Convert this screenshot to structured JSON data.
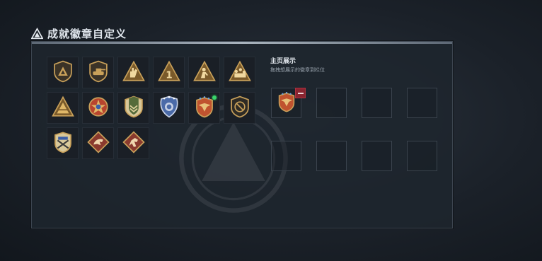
{
  "header": {
    "title": "成就徽章自定义",
    "icon": "triangle-logo-icon"
  },
  "badges": [
    {
      "icon": "shield-triangle-badge-icon",
      "row": 1
    },
    {
      "icon": "tank-badge-icon",
      "row": 1
    },
    {
      "icon": "hand-triangle-badge-icon",
      "row": 1
    },
    {
      "icon": "number-one-triangle-badge-icon",
      "row": 1
    },
    {
      "icon": "soldier-triangle-badge-icon",
      "row": 1
    },
    {
      "icon": "squad-triangle-badge-icon",
      "row": 1
    },
    {
      "icon": "gold-triangle-badge-icon",
      "row": 2
    },
    {
      "icon": "star-medal-badge-icon",
      "row": 2
    },
    {
      "icon": "chevron-shield-badge-icon",
      "row": 2
    },
    {
      "icon": "police-badge-icon",
      "row": 2
    },
    {
      "icon": "eagle-crest-badge-icon",
      "row": 2,
      "is_new": true
    },
    {
      "icon": "no-sign-shield-badge-icon",
      "row": 2
    },
    {
      "icon": "crossed-rifles-crest-badge-icon",
      "row": 3
    },
    {
      "icon": "beast-diamond-badge-icon",
      "row": 3
    },
    {
      "icon": "horse-diamond-badge-icon",
      "row": 3
    }
  ],
  "showcase": {
    "title": "主页展示",
    "subtitle": "拖拽想展示的徽章到栏位",
    "slots": [
      {
        "filled": true,
        "icon": "eagle-crest-badge-icon"
      },
      {
        "filled": false
      },
      {
        "filled": false
      },
      {
        "filled": false
      },
      {
        "filled": false
      },
      {
        "filled": false
      },
      {
        "filled": false
      },
      {
        "filled": false
      }
    ]
  },
  "colors": {
    "gold": "#c9a15a",
    "dark_gold": "#7a5a2a",
    "accent_red": "#8a2430",
    "new_dot": "#39d46a"
  }
}
